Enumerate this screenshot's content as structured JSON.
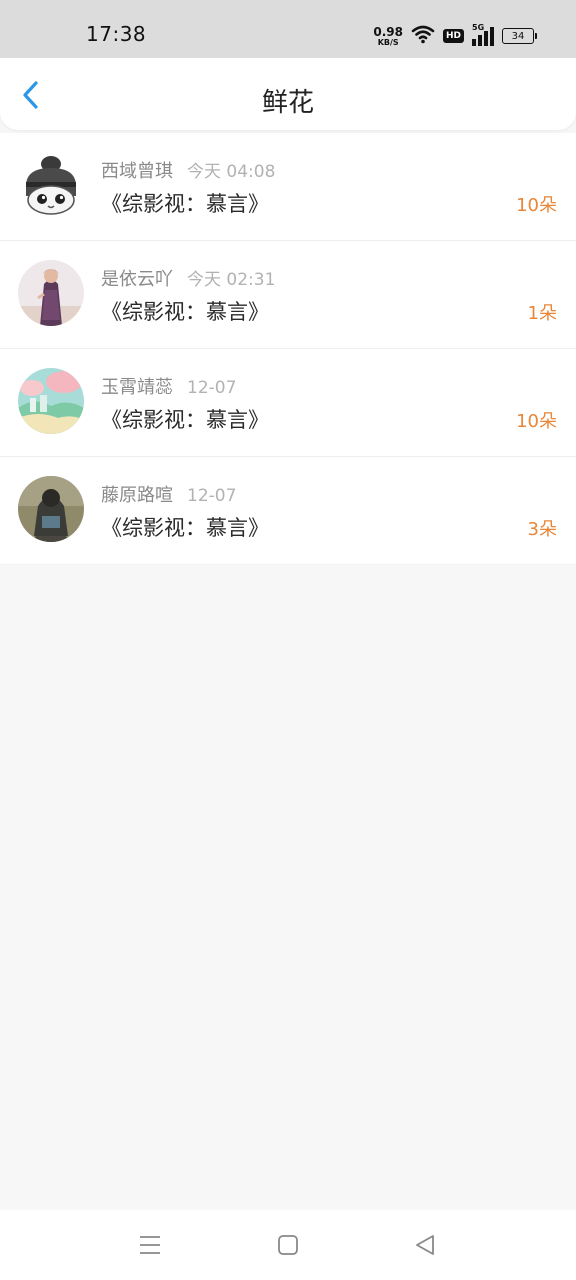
{
  "status_bar": {
    "time": "17:38",
    "net_speed_value": "0.98",
    "net_speed_unit": "KB/S",
    "hd_label": "HD",
    "signal_label": "5G",
    "battery": "34",
    "icons": [
      "wifi-icon",
      "hd-icon",
      "signal-5g-icon",
      "battery-icon"
    ]
  },
  "header": {
    "title": "鲜花",
    "back_icon": "chevron-left-icon",
    "accent_color": "#2b97e6"
  },
  "records": [
    {
      "name": "西域曾琪",
      "time": "今天 04:08",
      "book": "《综影视：慕言》",
      "count": "10朵"
    },
    {
      "name": "是依云吖",
      "time": "今天 02:31",
      "book": "《综影视：慕言》",
      "count": "1朵"
    },
    {
      "name": "玉霄靖蕊",
      "time": "12-07",
      "book": "《综影视：慕言》",
      "count": "10朵"
    },
    {
      "name": "藤原路喧",
      "time": "12-07",
      "book": "《综影视：慕言》",
      "count": "3朵"
    }
  ],
  "colors": {
    "count_color": "#e8863a",
    "background": "#f8f7f8"
  },
  "nav_bar": {
    "icons": [
      "menu-icon",
      "home-icon",
      "back-triangle-icon"
    ]
  }
}
